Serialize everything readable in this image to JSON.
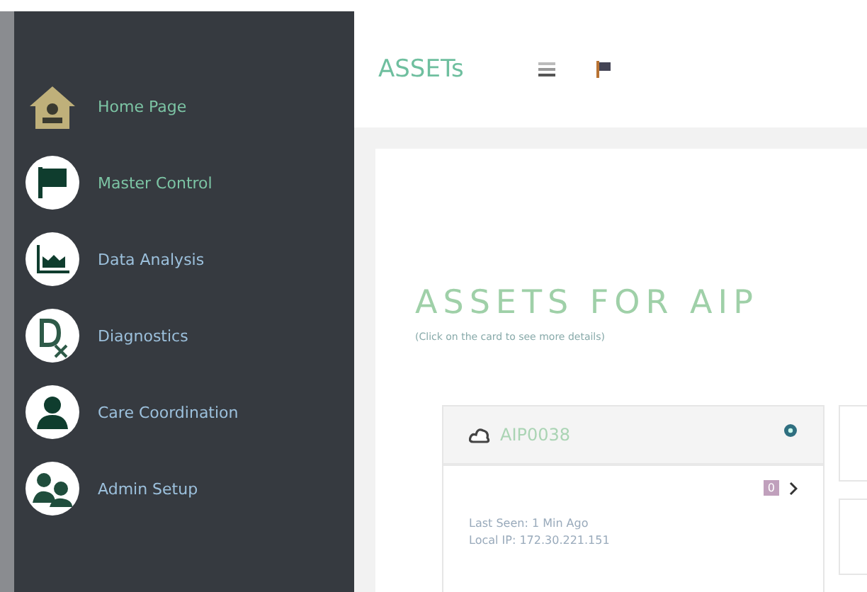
{
  "sidebar": {
    "items": [
      {
        "label": "Home Page",
        "highlighted": true
      },
      {
        "label": "Master Control",
        "highlighted": true
      },
      {
        "label": "Data Analysis",
        "highlighted": false
      },
      {
        "label": "Diagnostics",
        "highlighted": false
      },
      {
        "label": "Care Coordination",
        "highlighted": false
      },
      {
        "label": "Admin Setup",
        "highlighted": false
      }
    ]
  },
  "header": {
    "title": "ASSETs"
  },
  "page": {
    "title": "ASSETS FOR AIP",
    "subtitle": "(Click on the card to see more details)",
    "cards": [
      {
        "name": "AIP0038",
        "badge": "0",
        "lines": [
          "Last Seen: 1 Min Ago",
          "Local IP: 172.30.221.151"
        ]
      }
    ]
  }
}
